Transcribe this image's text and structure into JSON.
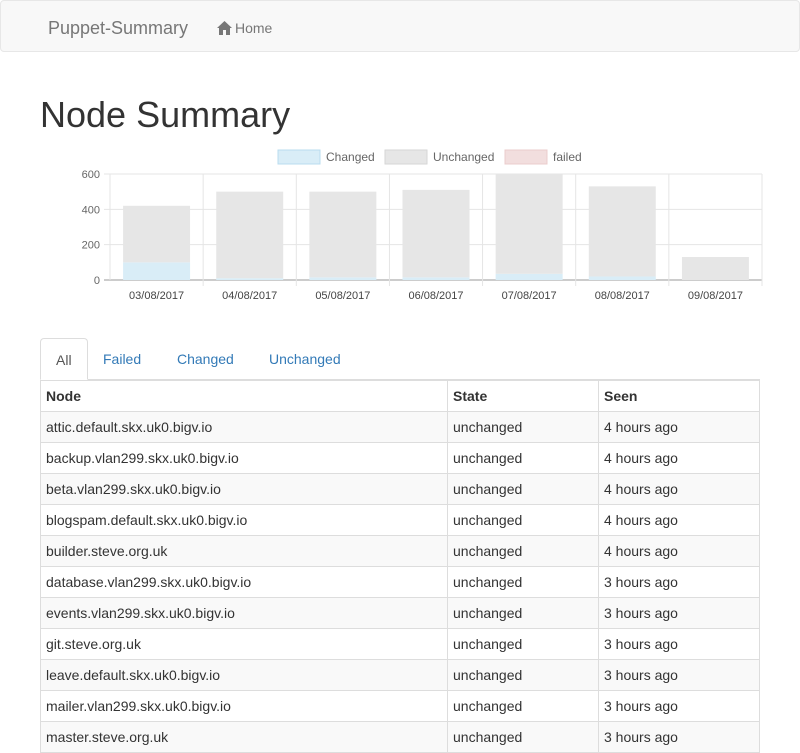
{
  "navbar": {
    "brand": "Puppet-Summary",
    "home_label": "Home",
    "home_icon": "home-icon"
  },
  "page_title": "Node Summary",
  "colors": {
    "changed": "#d9edf7",
    "unchanged": "#e6e6e6",
    "failed": "#f2dede",
    "link": "#337ab7"
  },
  "chart_data": {
    "type": "bar",
    "categories": [
      "03/08/2017",
      "04/08/2017",
      "05/08/2017",
      "06/08/2017",
      "07/08/2017",
      "08/08/2017",
      "09/08/2017"
    ],
    "series": [
      {
        "name": "Changed",
        "values": [
          100,
          10,
          15,
          15,
          35,
          20,
          0
        ]
      },
      {
        "name": "Unchanged",
        "values": [
          320,
          490,
          485,
          495,
          565,
          510,
          130
        ]
      },
      {
        "name": "failed",
        "values": [
          0,
          0,
          0,
          0,
          0,
          0,
          0
        ]
      }
    ],
    "stacked": true,
    "ylim": [
      0,
      600
    ],
    "yticks": [
      0,
      200,
      400,
      600
    ],
    "legend": "top",
    "grid": true
  },
  "tabs": [
    {
      "label": "All",
      "active": true
    },
    {
      "label": "Failed",
      "active": false
    },
    {
      "label": "Changed",
      "active": false
    },
    {
      "label": "Unchanged",
      "active": false
    }
  ],
  "table": {
    "headers": [
      "Node",
      "State",
      "Seen"
    ],
    "rows": [
      [
        "attic.default.skx.uk0.bigv.io",
        "unchanged",
        "4 hours ago"
      ],
      [
        "backup.vlan299.skx.uk0.bigv.io",
        "unchanged",
        "4 hours ago"
      ],
      [
        "beta.vlan299.skx.uk0.bigv.io",
        "unchanged",
        "4 hours ago"
      ],
      [
        "blogspam.default.skx.uk0.bigv.io",
        "unchanged",
        "4 hours ago"
      ],
      [
        "builder.steve.org.uk",
        "unchanged",
        "4 hours ago"
      ],
      [
        "database.vlan299.skx.uk0.bigv.io",
        "unchanged",
        "3 hours ago"
      ],
      [
        "events.vlan299.skx.uk0.bigv.io",
        "unchanged",
        "3 hours ago"
      ],
      [
        "git.steve.org.uk",
        "unchanged",
        "3 hours ago"
      ],
      [
        "leave.default.skx.uk0.bigv.io",
        "unchanged",
        "3 hours ago"
      ],
      [
        "mailer.vlan299.skx.uk0.bigv.io",
        "unchanged",
        "3 hours ago"
      ],
      [
        "master.steve.org.uk",
        "unchanged",
        "3 hours ago"
      ]
    ]
  }
}
